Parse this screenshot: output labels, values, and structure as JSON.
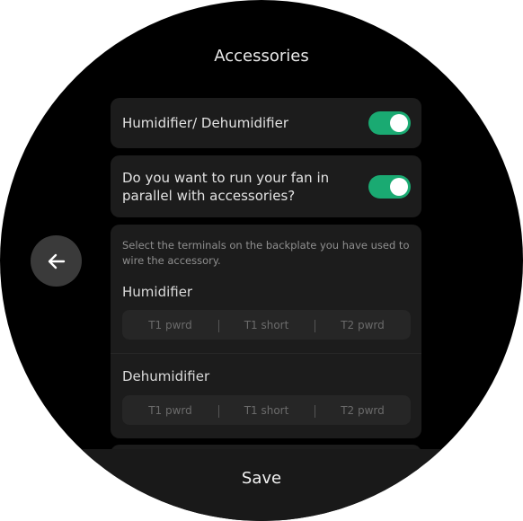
{
  "header": {
    "title": "Accessories"
  },
  "nav": {
    "back_icon": "arrow-left-icon"
  },
  "settings": {
    "humidifier_toggle": {
      "label": "Humidifier/ Dehumidifier",
      "on": true
    },
    "fan_parallel_toggle": {
      "label": "Do you want to run your fan in parallel with accessories?",
      "on": true
    }
  },
  "terminals": {
    "instructions": "Select the terminals on the backplate you have used to wire the accessory.",
    "humidifier": {
      "title": "Humidifier",
      "options": [
        "T1 pwrd",
        "T1 short",
        "T2 pwrd"
      ]
    },
    "dehumidifier": {
      "title": "Dehumidifier",
      "options": [
        "T1 pwrd",
        "T1 short",
        "T2 pwrd"
      ]
    }
  },
  "footer": {
    "save_label": "Save"
  },
  "colors": {
    "toggle_on": "#1aaa72",
    "card_bg": "#1c1c1c",
    "screen_bg": "#000000"
  }
}
